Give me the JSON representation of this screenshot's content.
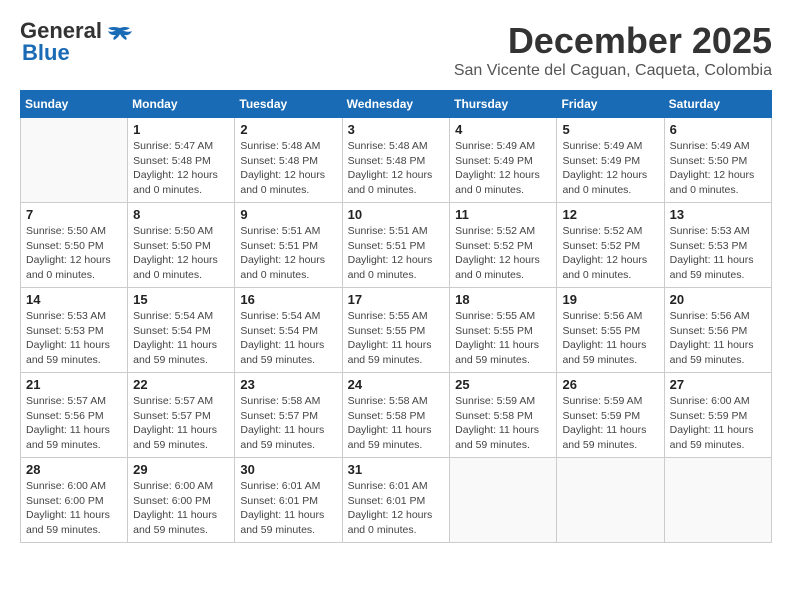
{
  "header": {
    "logo_general": "General",
    "logo_blue": "Blue",
    "month_title": "December 2025",
    "location": "San Vicente del Caguan, Caqueta, Colombia"
  },
  "days_of_week": [
    "Sunday",
    "Monday",
    "Tuesday",
    "Wednesday",
    "Thursday",
    "Friday",
    "Saturday"
  ],
  "weeks": [
    [
      {
        "day": "",
        "info": ""
      },
      {
        "day": "1",
        "info": "Sunrise: 5:47 AM\nSunset: 5:48 PM\nDaylight: 12 hours\nand 0 minutes."
      },
      {
        "day": "2",
        "info": "Sunrise: 5:48 AM\nSunset: 5:48 PM\nDaylight: 12 hours\nand 0 minutes."
      },
      {
        "day": "3",
        "info": "Sunrise: 5:48 AM\nSunset: 5:48 PM\nDaylight: 12 hours\nand 0 minutes."
      },
      {
        "day": "4",
        "info": "Sunrise: 5:49 AM\nSunset: 5:49 PM\nDaylight: 12 hours\nand 0 minutes."
      },
      {
        "day": "5",
        "info": "Sunrise: 5:49 AM\nSunset: 5:49 PM\nDaylight: 12 hours\nand 0 minutes."
      },
      {
        "day": "6",
        "info": "Sunrise: 5:49 AM\nSunset: 5:50 PM\nDaylight: 12 hours\nand 0 minutes."
      }
    ],
    [
      {
        "day": "7",
        "info": "Sunrise: 5:50 AM\nSunset: 5:50 PM\nDaylight: 12 hours\nand 0 minutes."
      },
      {
        "day": "8",
        "info": "Sunrise: 5:50 AM\nSunset: 5:50 PM\nDaylight: 12 hours\nand 0 minutes."
      },
      {
        "day": "9",
        "info": "Sunrise: 5:51 AM\nSunset: 5:51 PM\nDaylight: 12 hours\nand 0 minutes."
      },
      {
        "day": "10",
        "info": "Sunrise: 5:51 AM\nSunset: 5:51 PM\nDaylight: 12 hours\nand 0 minutes."
      },
      {
        "day": "11",
        "info": "Sunrise: 5:52 AM\nSunset: 5:52 PM\nDaylight: 12 hours\nand 0 minutes."
      },
      {
        "day": "12",
        "info": "Sunrise: 5:52 AM\nSunset: 5:52 PM\nDaylight: 12 hours\nand 0 minutes."
      },
      {
        "day": "13",
        "info": "Sunrise: 5:53 AM\nSunset: 5:53 PM\nDaylight: 11 hours\nand 59 minutes."
      }
    ],
    [
      {
        "day": "14",
        "info": "Sunrise: 5:53 AM\nSunset: 5:53 PM\nDaylight: 11 hours\nand 59 minutes."
      },
      {
        "day": "15",
        "info": "Sunrise: 5:54 AM\nSunset: 5:54 PM\nDaylight: 11 hours\nand 59 minutes."
      },
      {
        "day": "16",
        "info": "Sunrise: 5:54 AM\nSunset: 5:54 PM\nDaylight: 11 hours\nand 59 minutes."
      },
      {
        "day": "17",
        "info": "Sunrise: 5:55 AM\nSunset: 5:55 PM\nDaylight: 11 hours\nand 59 minutes."
      },
      {
        "day": "18",
        "info": "Sunrise: 5:55 AM\nSunset: 5:55 PM\nDaylight: 11 hours\nand 59 minutes."
      },
      {
        "day": "19",
        "info": "Sunrise: 5:56 AM\nSunset: 5:55 PM\nDaylight: 11 hours\nand 59 minutes."
      },
      {
        "day": "20",
        "info": "Sunrise: 5:56 AM\nSunset: 5:56 PM\nDaylight: 11 hours\nand 59 minutes."
      }
    ],
    [
      {
        "day": "21",
        "info": "Sunrise: 5:57 AM\nSunset: 5:56 PM\nDaylight: 11 hours\nand 59 minutes."
      },
      {
        "day": "22",
        "info": "Sunrise: 5:57 AM\nSunset: 5:57 PM\nDaylight: 11 hours\nand 59 minutes."
      },
      {
        "day": "23",
        "info": "Sunrise: 5:58 AM\nSunset: 5:57 PM\nDaylight: 11 hours\nand 59 minutes."
      },
      {
        "day": "24",
        "info": "Sunrise: 5:58 AM\nSunset: 5:58 PM\nDaylight: 11 hours\nand 59 minutes."
      },
      {
        "day": "25",
        "info": "Sunrise: 5:59 AM\nSunset: 5:58 PM\nDaylight: 11 hours\nand 59 minutes."
      },
      {
        "day": "26",
        "info": "Sunrise: 5:59 AM\nSunset: 5:59 PM\nDaylight: 11 hours\nand 59 minutes."
      },
      {
        "day": "27",
        "info": "Sunrise: 6:00 AM\nSunset: 5:59 PM\nDaylight: 11 hours\nand 59 minutes."
      }
    ],
    [
      {
        "day": "28",
        "info": "Sunrise: 6:00 AM\nSunset: 6:00 PM\nDaylight: 11 hours\nand 59 minutes."
      },
      {
        "day": "29",
        "info": "Sunrise: 6:00 AM\nSunset: 6:00 PM\nDaylight: 11 hours\nand 59 minutes."
      },
      {
        "day": "30",
        "info": "Sunrise: 6:01 AM\nSunset: 6:01 PM\nDaylight: 11 hours\nand 59 minutes."
      },
      {
        "day": "31",
        "info": "Sunrise: 6:01 AM\nSunset: 6:01 PM\nDaylight: 12 hours\nand 0 minutes."
      },
      {
        "day": "",
        "info": ""
      },
      {
        "day": "",
        "info": ""
      },
      {
        "day": "",
        "info": ""
      }
    ]
  ]
}
